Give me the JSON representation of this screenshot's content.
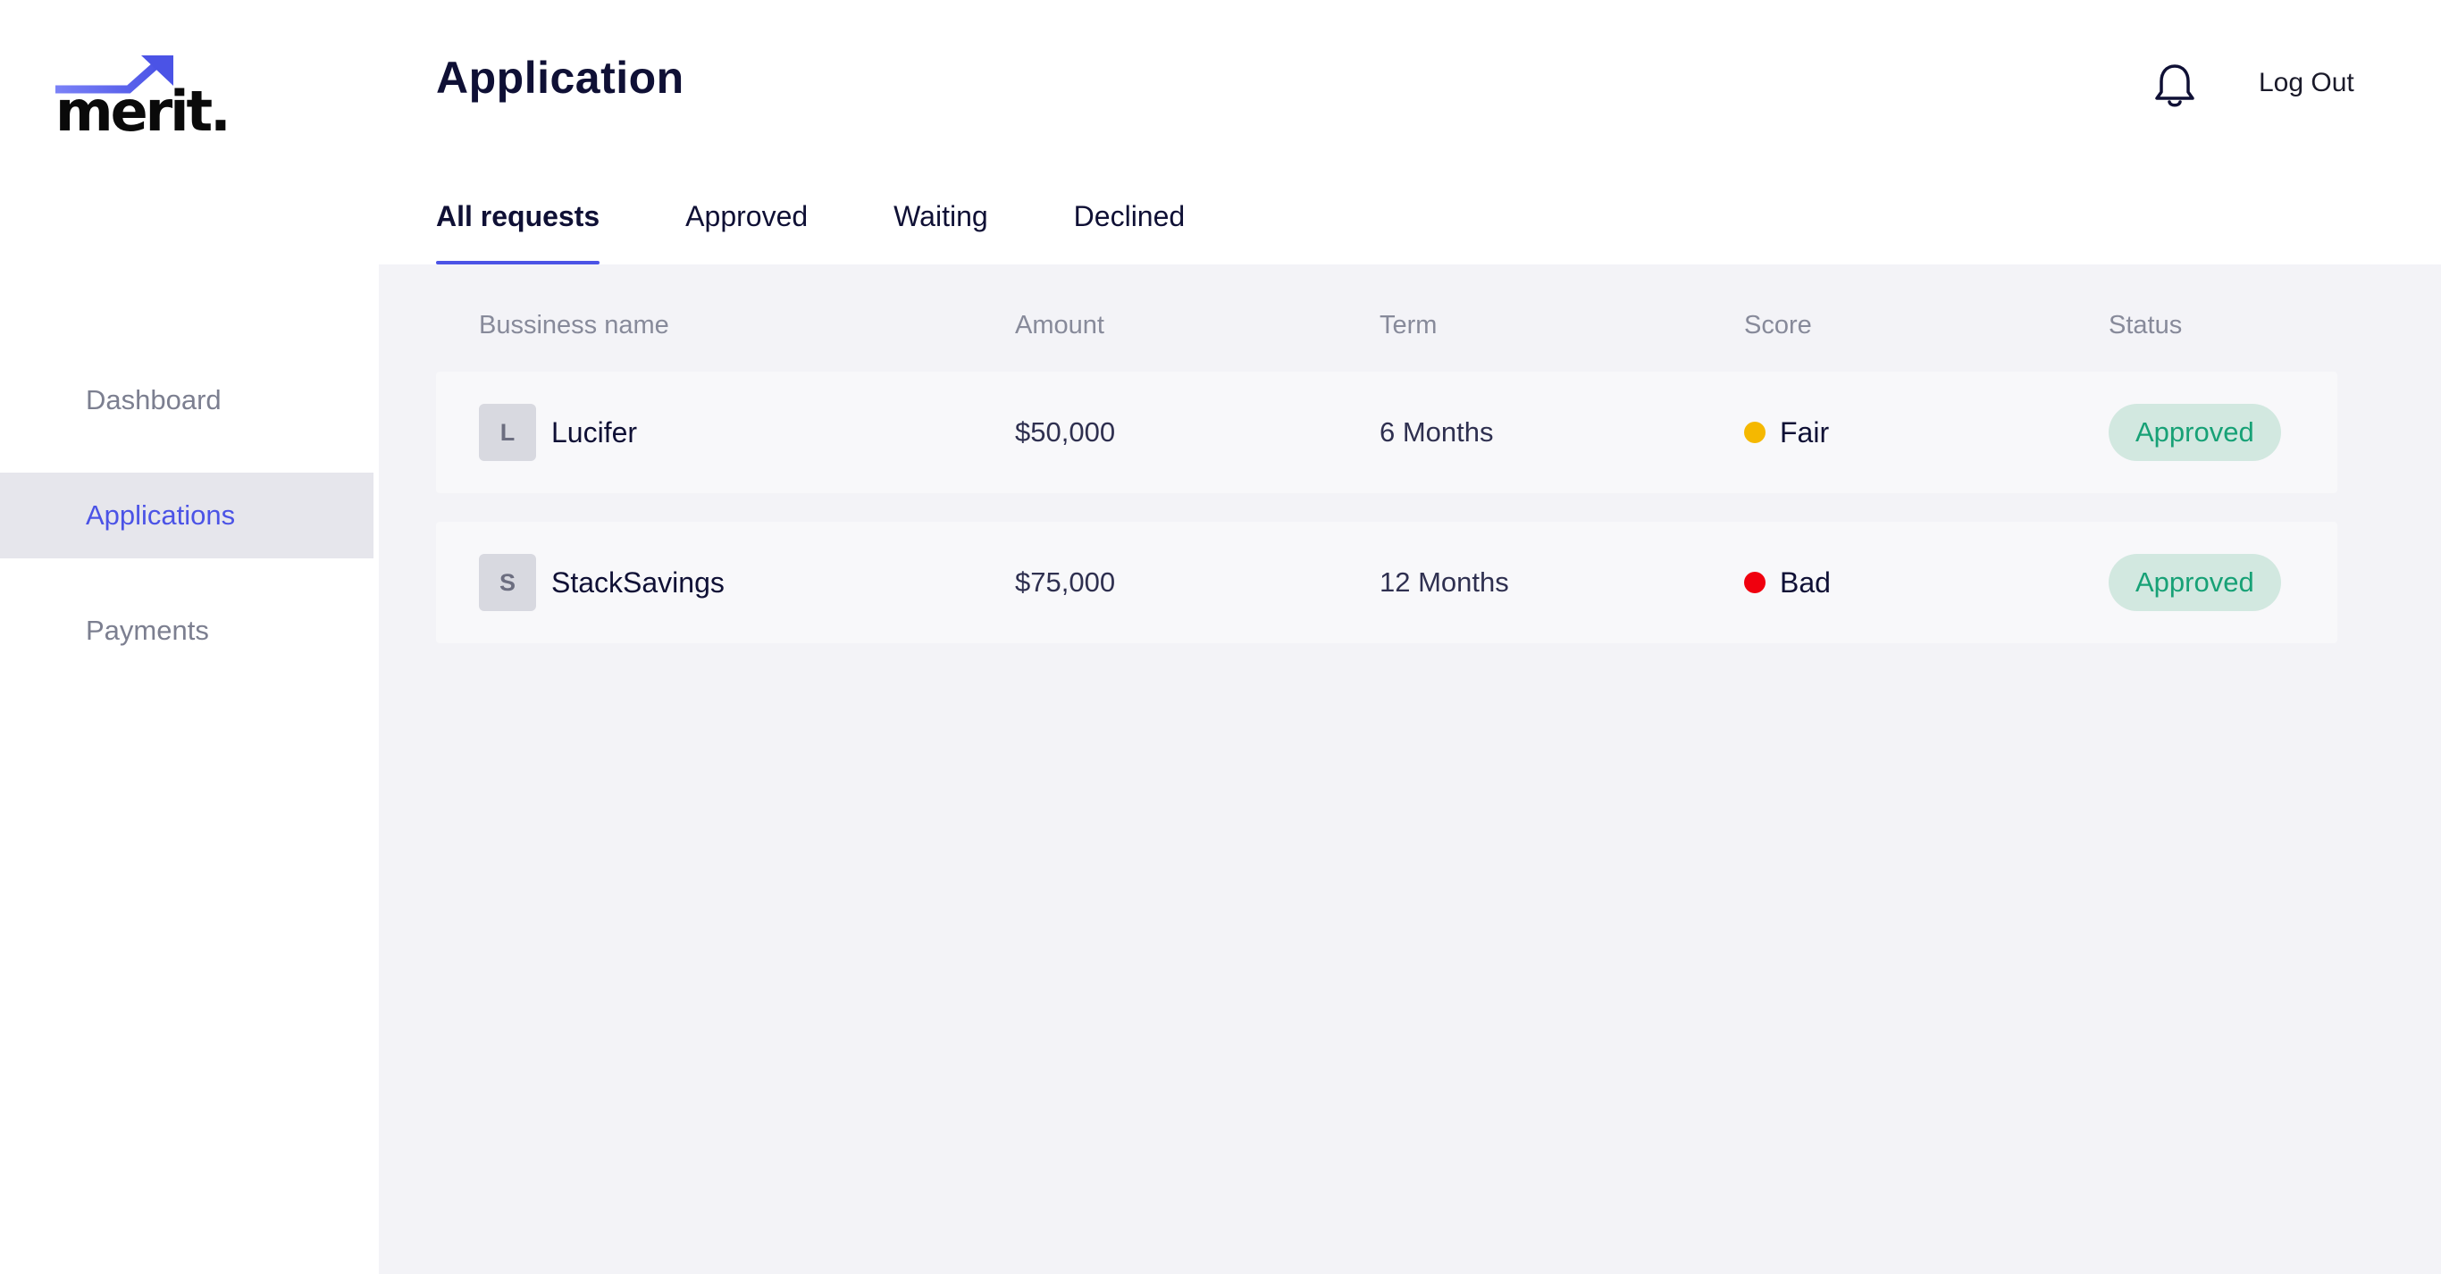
{
  "brand": {
    "name": "merit.",
    "accent": "#4b53e6"
  },
  "sidebar": {
    "items": [
      {
        "label": "Dashboard",
        "active": false
      },
      {
        "label": "Applications",
        "active": true
      },
      {
        "label": "Payments",
        "active": false
      }
    ]
  },
  "header": {
    "title": "Application",
    "notification_icon": "bell-icon",
    "logout_label": "Log Out"
  },
  "tabs": [
    {
      "label": "All requests",
      "active": true
    },
    {
      "label": "Approved",
      "active": false
    },
    {
      "label": "Waiting",
      "active": false
    },
    {
      "label": "Declined",
      "active": false
    }
  ],
  "table": {
    "columns": [
      "Bussiness name",
      "Amount",
      "Term",
      "Score",
      "Status"
    ],
    "rows": [
      {
        "initial": "L",
        "name": "Lucifer",
        "amount": "$50,000",
        "term": "6 Months",
        "score": "Fair",
        "score_color": "#f5b800",
        "status": "Approved"
      },
      {
        "initial": "S",
        "name": "StackSavings",
        "amount": "$75,000",
        "term": "12 Months",
        "score": "Bad",
        "score_color": "#f0000e",
        "status": "Approved"
      }
    ]
  },
  "colors": {
    "status_approved_bg": "#d2e8e0",
    "status_approved_text": "#17a176",
    "panel_bg": "#f3f3f7"
  }
}
